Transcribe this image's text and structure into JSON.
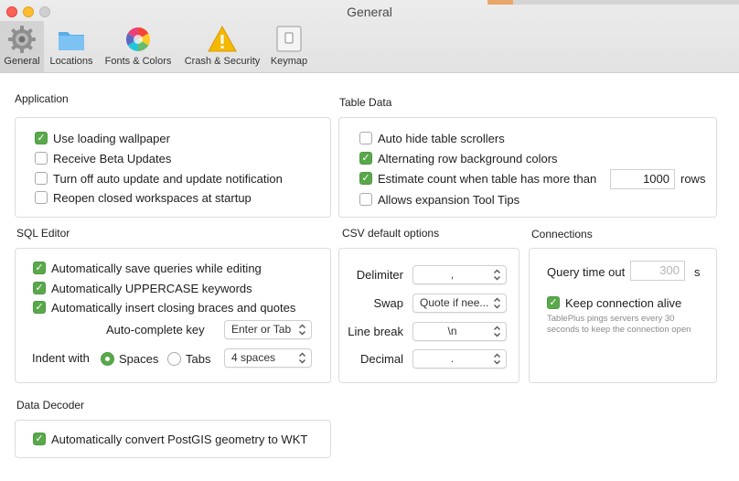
{
  "window": {
    "title": "General"
  },
  "toolbar": {
    "items": [
      {
        "label": "General"
      },
      {
        "label": "Locations"
      },
      {
        "label": "Fonts & Colors"
      },
      {
        "label": "Crash & Security"
      },
      {
        "label": "Keymap"
      }
    ]
  },
  "application": {
    "title": "Application",
    "options": [
      {
        "label": "Use loading wallpaper",
        "checked": true
      },
      {
        "label": "Receive Beta Updates",
        "checked": false
      },
      {
        "label": "Turn off auto update and update notification",
        "checked": false
      },
      {
        "label": "Reopen closed workspaces at startup",
        "checked": false
      }
    ]
  },
  "table_data": {
    "title": "Table Data",
    "options": [
      {
        "label": "Auto hide table scrollers",
        "checked": false
      },
      {
        "label": "Alternating row background colors",
        "checked": true
      },
      {
        "label": "Estimate count when table has more than",
        "checked": true
      },
      {
        "label": "Allows expansion Tool Tips",
        "checked": false
      }
    ],
    "estimate_value": "1000",
    "estimate_unit": "rows"
  },
  "sql_editor": {
    "title": "SQL Editor",
    "options": [
      {
        "label": "Automatically save queries while editing",
        "checked": true
      },
      {
        "label": "Automatically UPPERCASE keywords",
        "checked": true
      },
      {
        "label": "Automatically insert closing braces and quotes",
        "checked": true
      }
    ],
    "autocomplete_label": "Auto-complete key",
    "autocomplete_value": "Enter or Tab",
    "indent_label": "Indent with",
    "indent_spaces": "Spaces",
    "indent_tabs": "Tabs",
    "indent_selected": "Spaces",
    "indent_size": "4 spaces"
  },
  "csv": {
    "title": "CSV default options",
    "fields": [
      {
        "label": "Delimiter",
        "value": ","
      },
      {
        "label": "Swap",
        "value": "Quote if nee..."
      },
      {
        "label": "Line break",
        "value": "\\n"
      },
      {
        "label": "Decimal",
        "value": "."
      }
    ]
  },
  "connections": {
    "title": "Connections",
    "timeout_label": "Query time out",
    "timeout_placeholder": "300",
    "timeout_unit": "s",
    "keep_alive_label": "Keep connection alive",
    "keep_alive_checked": true,
    "note": "TablePlus pings servers every 30 seconds to keep the connection open"
  },
  "data_decoder": {
    "title": "Data Decoder",
    "options": [
      {
        "label": "Automatically convert PostGIS geometry to WKT",
        "checked": true
      }
    ]
  },
  "colors": {
    "accent_green": "#59a84b",
    "selected_tab": "#d3d3d3"
  }
}
